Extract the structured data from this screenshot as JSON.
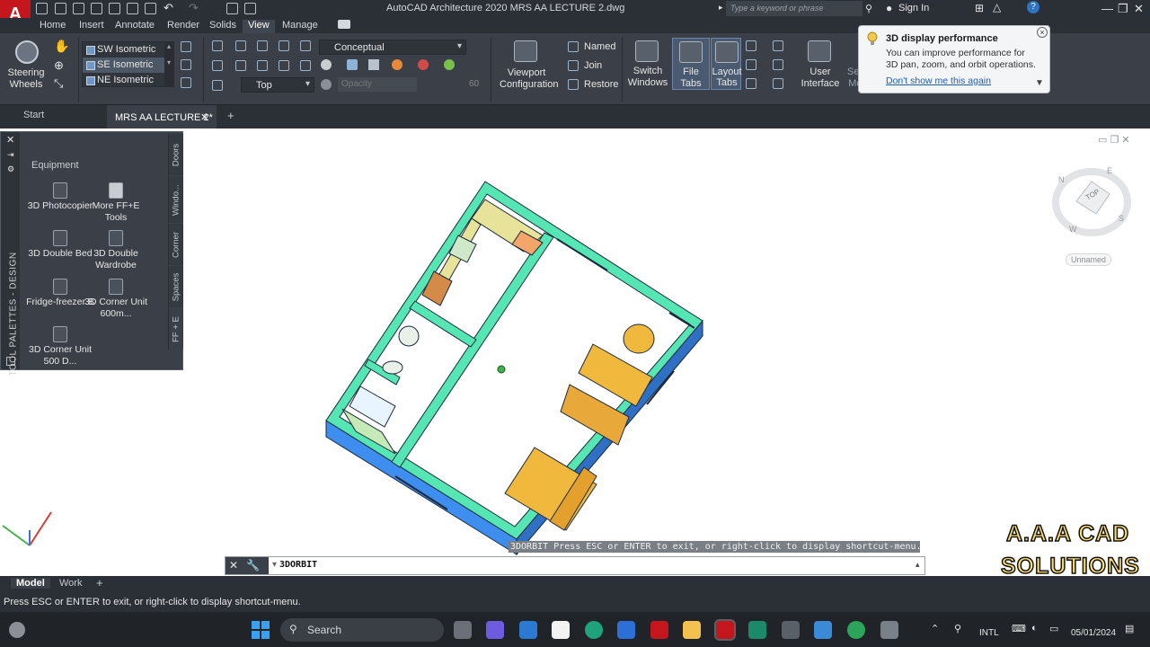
{
  "app": {
    "logo_letter": "A",
    "title": "AutoCAD Architecture 2020   MRS AA LECTURE 2.dwg",
    "search_placeholder": "Type a keyword or phrase",
    "sign_in": "Sign In"
  },
  "ribbon_tabs": [
    "Home",
    "Insert",
    "Annotate",
    "Render",
    "Solids",
    "View",
    "Manage"
  ],
  "active_ribbon_tab": "View",
  "ribbon": {
    "steering_wheels": "Steering Wheels",
    "views": [
      "SW Isometric",
      "SE Isometric",
      "NE Isometric"
    ],
    "selected_view": "SE Isometric",
    "visual_style": "Conceptual",
    "view_top": "Top",
    "opacity_label": "Opacity",
    "opacity_value": "60",
    "viewport_configuration": "Viewport Configuration",
    "named": "Named",
    "join": "Join",
    "restore": "Restore",
    "switch_windows": "Switch Windows",
    "file_tabs": "File Tabs",
    "layout_tabs": "Layout Tabs",
    "user_interface": "User Interface",
    "select_mode": "Select Mode"
  },
  "notification": {
    "title": "3D display performance",
    "body": "You can improve performance for 3D pan, zoom, and orbit operations.",
    "link": "Don't show me this again"
  },
  "file_tabs": {
    "start": "Start",
    "active": "MRS AA LECTURE 2*"
  },
  "tool_palette": {
    "title": "TOOL PALETTES - DESIGN",
    "heading": "Equipment",
    "items": [
      "3D Photocopier",
      "More FF+E Tools",
      "3D Double Bed",
      "3D Double Wardrobe",
      "Fridge-freezer B",
      "3D Corner Unit 600m...",
      "3D Corner Unit 500 D..."
    ],
    "side_tabs": [
      "Doors",
      "Windo...",
      "Corner",
      "Spaces",
      "FF + E"
    ]
  },
  "viewcube": {
    "face": "TOP",
    "compass": [
      "N",
      "E",
      "S",
      "W"
    ],
    "ucs_label": "Unnamed"
  },
  "command": {
    "history": "3DORBIT Press ESC or ENTER to exit, or right-click to display shortcut-menu.",
    "current": "3DORBIT"
  },
  "layout_tabs": [
    "Model",
    "Work"
  ],
  "active_layout": "Model",
  "status_text": "Press ESC or ENTER to exit, or right-click to display shortcut-menu.",
  "watermark": [
    "A.A.A CAD",
    "SOLUTIONS"
  ],
  "taskbar": {
    "search": "Search",
    "lang": "INTL",
    "date": "05/01/2024"
  },
  "colors": {
    "wall_top": "#56e6b4",
    "wall_side": "#3e8ef0",
    "furniture": "#f0b83c",
    "kitchen_counter": "#e8e39a",
    "ribbon_bg": "#3b4048"
  }
}
